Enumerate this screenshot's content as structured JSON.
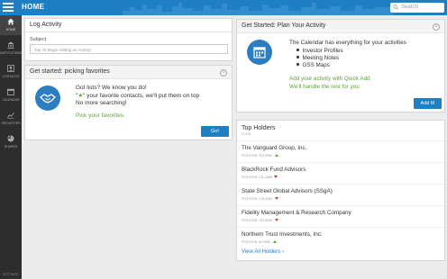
{
  "header": {
    "title": "HOME",
    "search_placeholder": "Search"
  },
  "sidebar": {
    "items": [
      {
        "label": "Home",
        "icon": "home-icon"
      },
      {
        "label": "Institutions",
        "icon": "institution-icon"
      },
      {
        "label": "Contacts",
        "icon": "contacts-icon"
      },
      {
        "label": "Calendar",
        "icon": "calendar-icon"
      },
      {
        "label": "Securities",
        "icon": "chart-icon"
      },
      {
        "label": "Shares",
        "icon": "pie-icon"
      }
    ],
    "footer": "Settings"
  },
  "log_activity": {
    "title": "Log Activity",
    "subject_label": "Subject",
    "subject_placeholder": "Tap To Begin Adding an Activity"
  },
  "favorites": {
    "title": "Get started: picking favorites",
    "line1": "Got lists? We know you do!",
    "line2_pre": "\"",
    "line2_post": "\" your favorite contacts, we'll put them on top",
    "line3": "No more searching!",
    "link": "Pick your favorites",
    "button": "Go!"
  },
  "plan": {
    "title": "Get Started: Plan Your Activity",
    "intro": "The Calendar has everything for your activities",
    "items": [
      "Investor Profiles",
      "Meeting Notes",
      "GSS Maps"
    ],
    "green1": "Add your activity with Quick Add",
    "green2": "We'll handle the rest for you",
    "button": "Add It!"
  },
  "holders": {
    "title": "Top Holders",
    "subtitle": "PLAIN",
    "rows": [
      {
        "name": "The Vanguard Group, Inc.",
        "position": "POSITION: 323,095K",
        "trend": "up"
      },
      {
        "name": "BlackRock Fund Advisors",
        "position": "POSITION: 211,185K",
        "trend": "down"
      },
      {
        "name": "State Street Global Advisors (SSgA)",
        "position": "POSITION: 213,449K",
        "trend": "down"
      },
      {
        "name": "Fidelity Management & Research Company",
        "position": "POSITION: 131,959K",
        "trend": "down"
      },
      {
        "name": "Northern Trust Investments, Inc.",
        "position": "POSITION: 64,055K",
        "trend": "up"
      }
    ],
    "view_all": "View All Holders"
  },
  "colors": {
    "brand_blue": "#1f7fc4",
    "green": "#5aa630",
    "red": "#d23b3b"
  }
}
